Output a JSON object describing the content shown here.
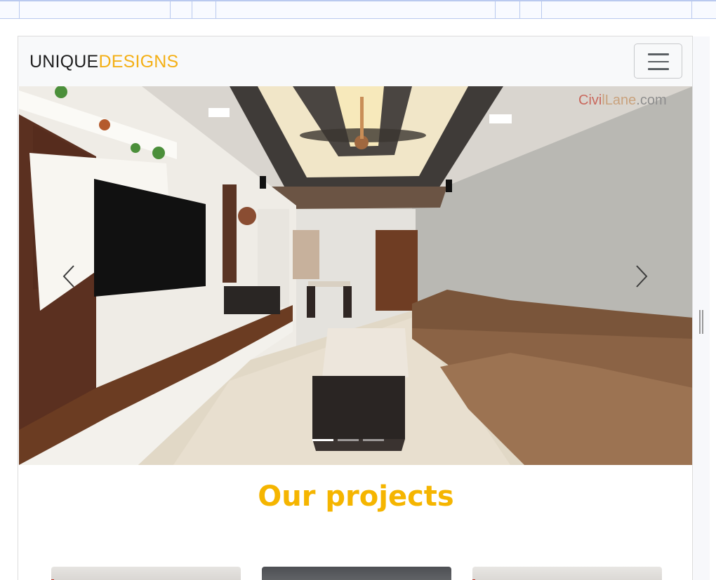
{
  "navbar": {
    "brand_part1": "UNIQUE",
    "brand_part2": "DESIGNS",
    "toggler_icon": "hamburger-icon"
  },
  "carousel": {
    "watermark_part1": "Civi",
    "watermark_part2": "lLane",
    "watermark_part3": ".com",
    "prev_icon": "chevron-left-icon",
    "next_icon": "chevron-right-icon",
    "slide_image": "living-room-interior",
    "active_index": 0,
    "slide_count": 3
  },
  "section": {
    "title": "Our projects"
  },
  "projects": [
    {
      "image": "project-thumbnail-1"
    },
    {
      "image": "project-thumbnail-2"
    },
    {
      "image": "project-thumbnail-3"
    }
  ],
  "colors": {
    "brand_accent": "#f4b016",
    "section_title": "#f5b500",
    "navbar_bg": "#f8f9fa"
  }
}
